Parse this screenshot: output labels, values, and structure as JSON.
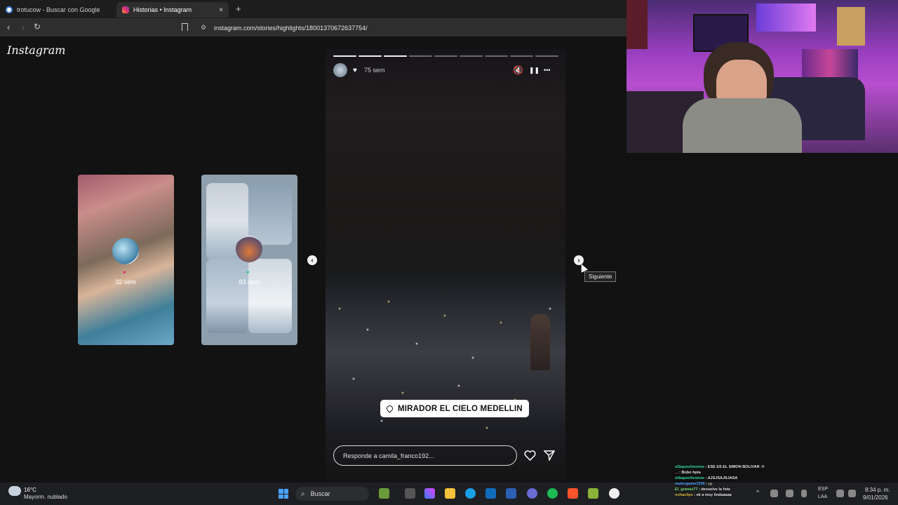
{
  "browser": {
    "tabs": [
      {
        "title": "trotucow - Buscar con Google",
        "icon": "google-icon",
        "active": false
      },
      {
        "title": "Historias • Instagram",
        "icon": "instagram-icon",
        "active": true
      }
    ],
    "new_tab": "+",
    "close": "×",
    "url": "instagram.com/stories/highlights/18001370672637754/"
  },
  "instagram": {
    "logo": "Instagram",
    "side_cards": [
      {
        "time": "32 sem",
        "heart": "♥"
      },
      {
        "time": "83 sem",
        "heart": "♥"
      }
    ],
    "story": {
      "progress_segments": 9,
      "active_segment": 3,
      "heart": "♥",
      "time": "75 sem",
      "controls": {
        "mute": "🔇",
        "pause": "❚❚",
        "more": "•••"
      },
      "location_sticker": "MIRADOR EL CIELO MEDELLIN",
      "reply_placeholder": "Responde a camila_franco192...",
      "like_icon": "heart-outline-icon",
      "share_icon": "send-icon"
    },
    "prev_arrow": "‹",
    "next_arrow": "›",
    "tooltip": "Siguiente"
  },
  "taskbar": {
    "weather_temp": "16°C",
    "weather_desc": "Mayorm. nublado",
    "search": "Buscar",
    "lang_1": "ESP",
    "lang_2": "LAA",
    "time": "8:34 p. m.",
    "date": "9/01/2026"
  },
  "chat": [
    {
      "user": "elSapooXeneize",
      "msg": ": ESE ES EL SIMON BOLIVAR :V"
    },
    {
      "user": "...",
      "msg": ": Bobo hpta"
    },
    {
      "user": "elSapooXeneize",
      "msg": ": AJSJSAJSJASA"
    },
    {
      "user": "mateogame3336",
      "msg": ": ¡¡¡"
    },
    {
      "user": "El_granas77",
      "msg": ": devuelve la foto"
    },
    {
      "user": "nohaclips",
      "msg": ": ek a muy lindaaaaa"
    }
  ]
}
